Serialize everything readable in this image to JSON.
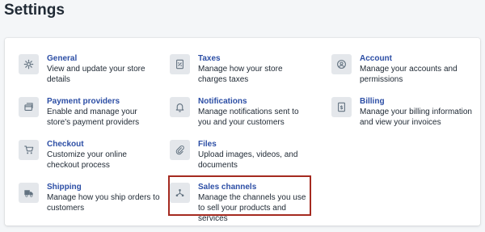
{
  "page": {
    "title": "Settings"
  },
  "settings": [
    {
      "title": "General",
      "desc": "View and update your store details",
      "icon": "gear-icon"
    },
    {
      "title": "Payment providers",
      "desc": "Enable and manage your store's payment providers",
      "icon": "payment-card-icon"
    },
    {
      "title": "Checkout",
      "desc": "Customize your online checkout process",
      "icon": "cart-icon"
    },
    {
      "title": "Shipping",
      "desc": "Manage how you ship orders to customers",
      "icon": "truck-icon"
    },
    {
      "title": "Taxes",
      "desc": "Manage how your store charges taxes",
      "icon": "tax-receipt-icon"
    },
    {
      "title": "Notifications",
      "desc": "Manage notifications sent to you and your customers",
      "icon": "bell-icon"
    },
    {
      "title": "Files",
      "desc": "Upload images, videos, and documents",
      "icon": "paperclip-icon"
    },
    {
      "title": "Sales channels",
      "desc": "Manage the channels you use to sell your products and services",
      "icon": "channels-icon"
    },
    {
      "title": "Account",
      "desc": "Manage your accounts and permissions",
      "icon": "user-circle-icon"
    },
    {
      "title": "Billing",
      "desc": "Manage your billing information and view your invoices",
      "icon": "billing-icon"
    }
  ],
  "colors": {
    "link": "#2c4ea5",
    "highlight_border": "#a52a20",
    "icon_background": "#e4e7eb",
    "page_background": "#f4f6f8"
  }
}
